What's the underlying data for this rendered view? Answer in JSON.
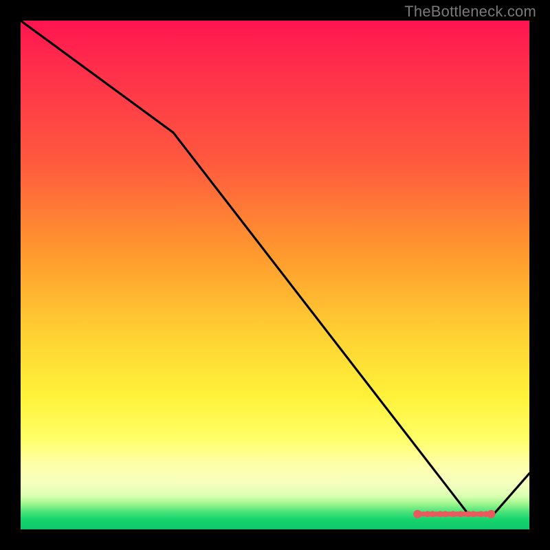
{
  "watermark": "TheBottleneck.com",
  "chart_data": {
    "type": "line",
    "title": "",
    "xlabel": "",
    "ylabel": "",
    "xlim": [
      0,
      100
    ],
    "ylim": [
      0,
      100
    ],
    "series": [
      {
        "name": "curve",
        "x": [
          0,
          30,
          88,
          93,
          100
        ],
        "values": [
          100,
          78,
          3,
          3,
          11
        ]
      }
    ],
    "markers": {
      "name": "highlight-cluster",
      "x": [
        78,
        80,
        81,
        82.5,
        83.5,
        85,
        86.5,
        88,
        89,
        90.5,
        91.5,
        92.5
      ],
      "values": [
        3,
        3,
        3,
        3,
        3,
        3,
        3,
        3,
        3,
        3,
        3,
        3
      ],
      "color": "#e85a5d"
    }
  }
}
